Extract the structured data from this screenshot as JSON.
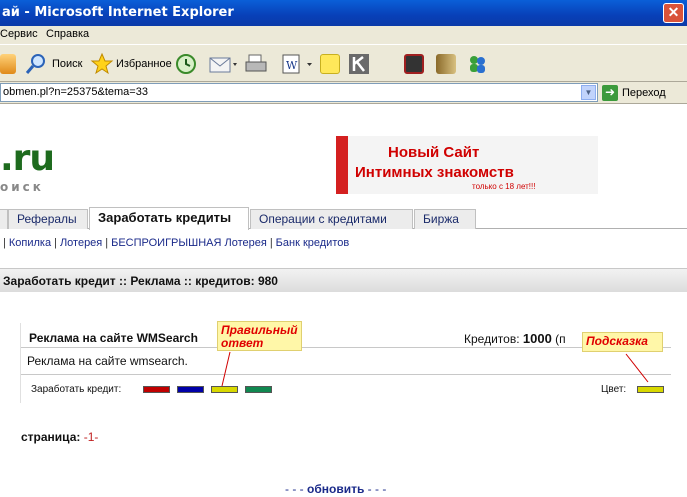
{
  "window": {
    "title": "ай - Microsoft Internet Explorer",
    "close_label": "✕"
  },
  "menubar": {
    "items": [
      "Сервис",
      "Справка"
    ]
  },
  "toolbar": {
    "search_label": "Поиск",
    "favorites_label": "Избранное"
  },
  "address": {
    "url": "obmen.pl?n=25375&tema=33",
    "go_label": "Переход"
  },
  "logo": {
    "text": ".ru",
    "subtitle": "оиск"
  },
  "banner": {
    "line1": "Новый Сайт",
    "line2": "Интимных знакомств",
    "line3": "только с 18 лет!!!"
  },
  "tabs": [
    "Рефералы",
    "Заработать кредиты",
    "Операции с кредитами",
    "Биржа"
  ],
  "subnav": [
    "Копилка",
    "Лотерея",
    "БЕСПРОИГРЫШНАЯ Лотерея",
    "Банк кредитов"
  ],
  "section_title": "Заработать кредит :: Реклама :: кредитов: 980",
  "ad": {
    "title": "Реклама на сайте WMSearch",
    "credits_label": "Кредитов:",
    "credits_value": "1000",
    "credits_suffix": "(п",
    "description": "Реклама на сайте wmsearch.",
    "earn_label": "Заработать кредит:",
    "color_label": "Цвет:",
    "buttons": [
      {
        "name": "red",
        "color": "#c00000"
      },
      {
        "name": "blue",
        "color": "#0000a8"
      },
      {
        "name": "yellow",
        "color": "#d8d800"
      },
      {
        "name": "green",
        "color": "#108850"
      }
    ],
    "hint_color": "#d8d800"
  },
  "callouts": {
    "correct": "Правильный ответ",
    "hint": "Подсказка"
  },
  "pagination": {
    "label": "страница:",
    "current": "-1-"
  },
  "refresh": {
    "prefix": "- - -",
    "label": "обновить",
    "suffix": "- - -"
  }
}
